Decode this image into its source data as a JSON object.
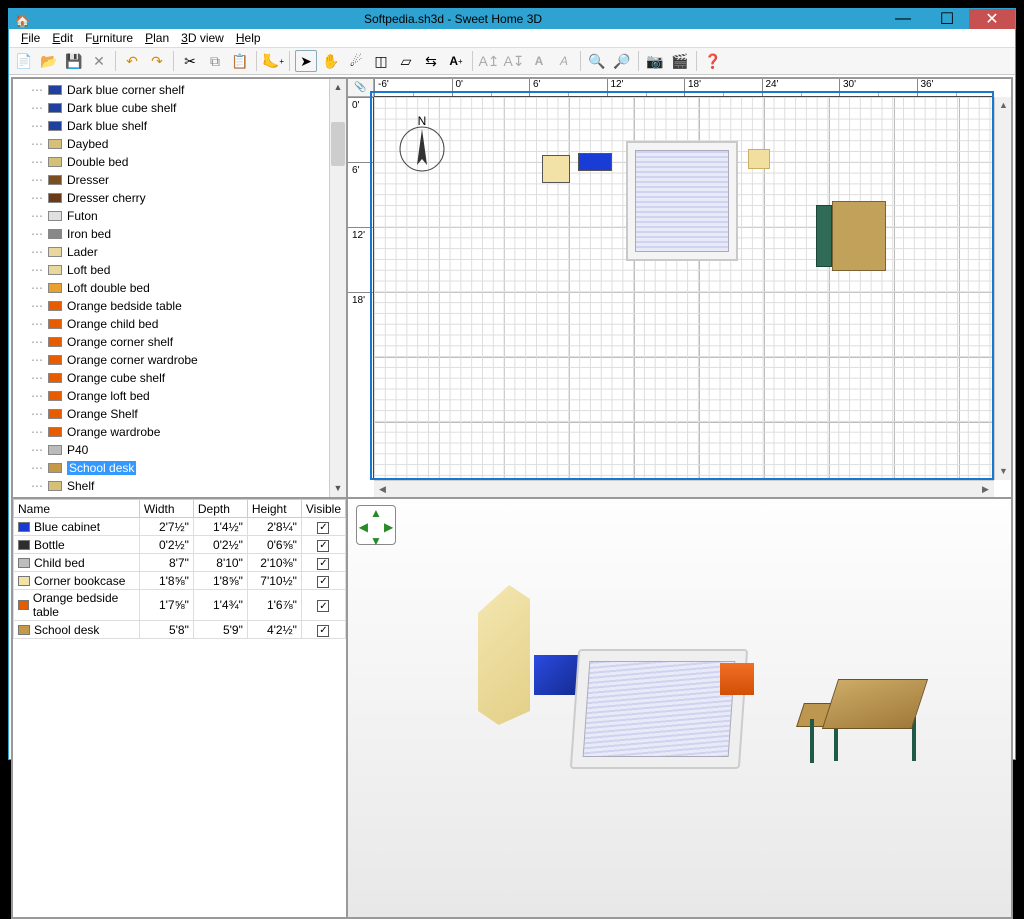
{
  "app": {
    "title": "Softpedia.sh3d - Sweet Home 3D"
  },
  "menu": {
    "file": "File",
    "edit": "Edit",
    "furniture": "Furniture",
    "plan": "Plan",
    "view3d": "3D view",
    "help": "Help"
  },
  "catalog": {
    "items": [
      {
        "label": "Dark blue corner shelf",
        "color": "#2040a0"
      },
      {
        "label": "Dark blue cube shelf",
        "color": "#2040a0"
      },
      {
        "label": "Dark blue shelf",
        "color": "#2040a0"
      },
      {
        "label": "Daybed",
        "color": "#d6c078"
      },
      {
        "label": "Double bed",
        "color": "#d6c078"
      },
      {
        "label": "Dresser",
        "color": "#7a4e20"
      },
      {
        "label": "Dresser cherry",
        "color": "#6a3a18"
      },
      {
        "label": "Futon",
        "color": "#e0e0e0"
      },
      {
        "label": "Iron bed",
        "color": "#888"
      },
      {
        "label": "Lader",
        "color": "#e8d8a0"
      },
      {
        "label": "Loft bed",
        "color": "#e8d8a0"
      },
      {
        "label": "Loft double bed",
        "color": "#e8a030"
      },
      {
        "label": "Orange bedside table",
        "color": "#e85c00"
      },
      {
        "label": "Orange child bed",
        "color": "#e85c00"
      },
      {
        "label": "Orange corner shelf",
        "color": "#e85c00"
      },
      {
        "label": "Orange corner wardrobe",
        "color": "#e85c00"
      },
      {
        "label": "Orange cube shelf",
        "color": "#e85c00"
      },
      {
        "label": "Orange loft bed",
        "color": "#e85c00"
      },
      {
        "label": "Orange Shelf",
        "color": "#e85c00"
      },
      {
        "label": "Orange wardrobe",
        "color": "#e85c00"
      },
      {
        "label": "P40",
        "color": "#bbb"
      },
      {
        "label": "School desk",
        "color": "#c49a4a",
        "selected": true
      },
      {
        "label": "Shelf",
        "color": "#d6c078"
      }
    ]
  },
  "furnTable": {
    "cols": {
      "name": "Name",
      "width": "Width",
      "depth": "Depth",
      "height": "Height",
      "visible": "Visible"
    },
    "rows": [
      {
        "name": "Blue cabinet",
        "color": "#1a3cd6",
        "width": "2'7½\"",
        "depth": "1'4½\"",
        "height": "2'8¼\"",
        "visible": true
      },
      {
        "name": "Bottle",
        "color": "#2d2d2d",
        "width": "0'2½\"",
        "depth": "0'2½\"",
        "height": "0'6⅝\"",
        "visible": true
      },
      {
        "name": "Child bed",
        "color": "#bdbdbd",
        "width": "8'7\"",
        "depth": "8'10\"",
        "height": "2'10⅜\"",
        "visible": true
      },
      {
        "name": "Corner bookcase",
        "color": "#f2e2a8",
        "width": "1'8⅝\"",
        "depth": "1'8⅝\"",
        "height": "7'10½\"",
        "visible": true
      },
      {
        "name": "Orange bedside table",
        "color": "#e85c00",
        "width": "1'7⅝\"",
        "depth": "1'4¾\"",
        "height": "1'6⅞\"",
        "visible": true
      },
      {
        "name": "School desk",
        "color": "#c49a4a",
        "width": "5'8\"",
        "depth": "5'9\"",
        "height": "4'2½\"",
        "visible": true
      }
    ]
  },
  "ruler": {
    "h": [
      "-6'",
      "0'",
      "6'",
      "12'",
      "18'",
      "24'",
      "30'",
      "36'"
    ],
    "v": [
      "0'",
      "6'",
      "12'",
      "18'"
    ]
  }
}
